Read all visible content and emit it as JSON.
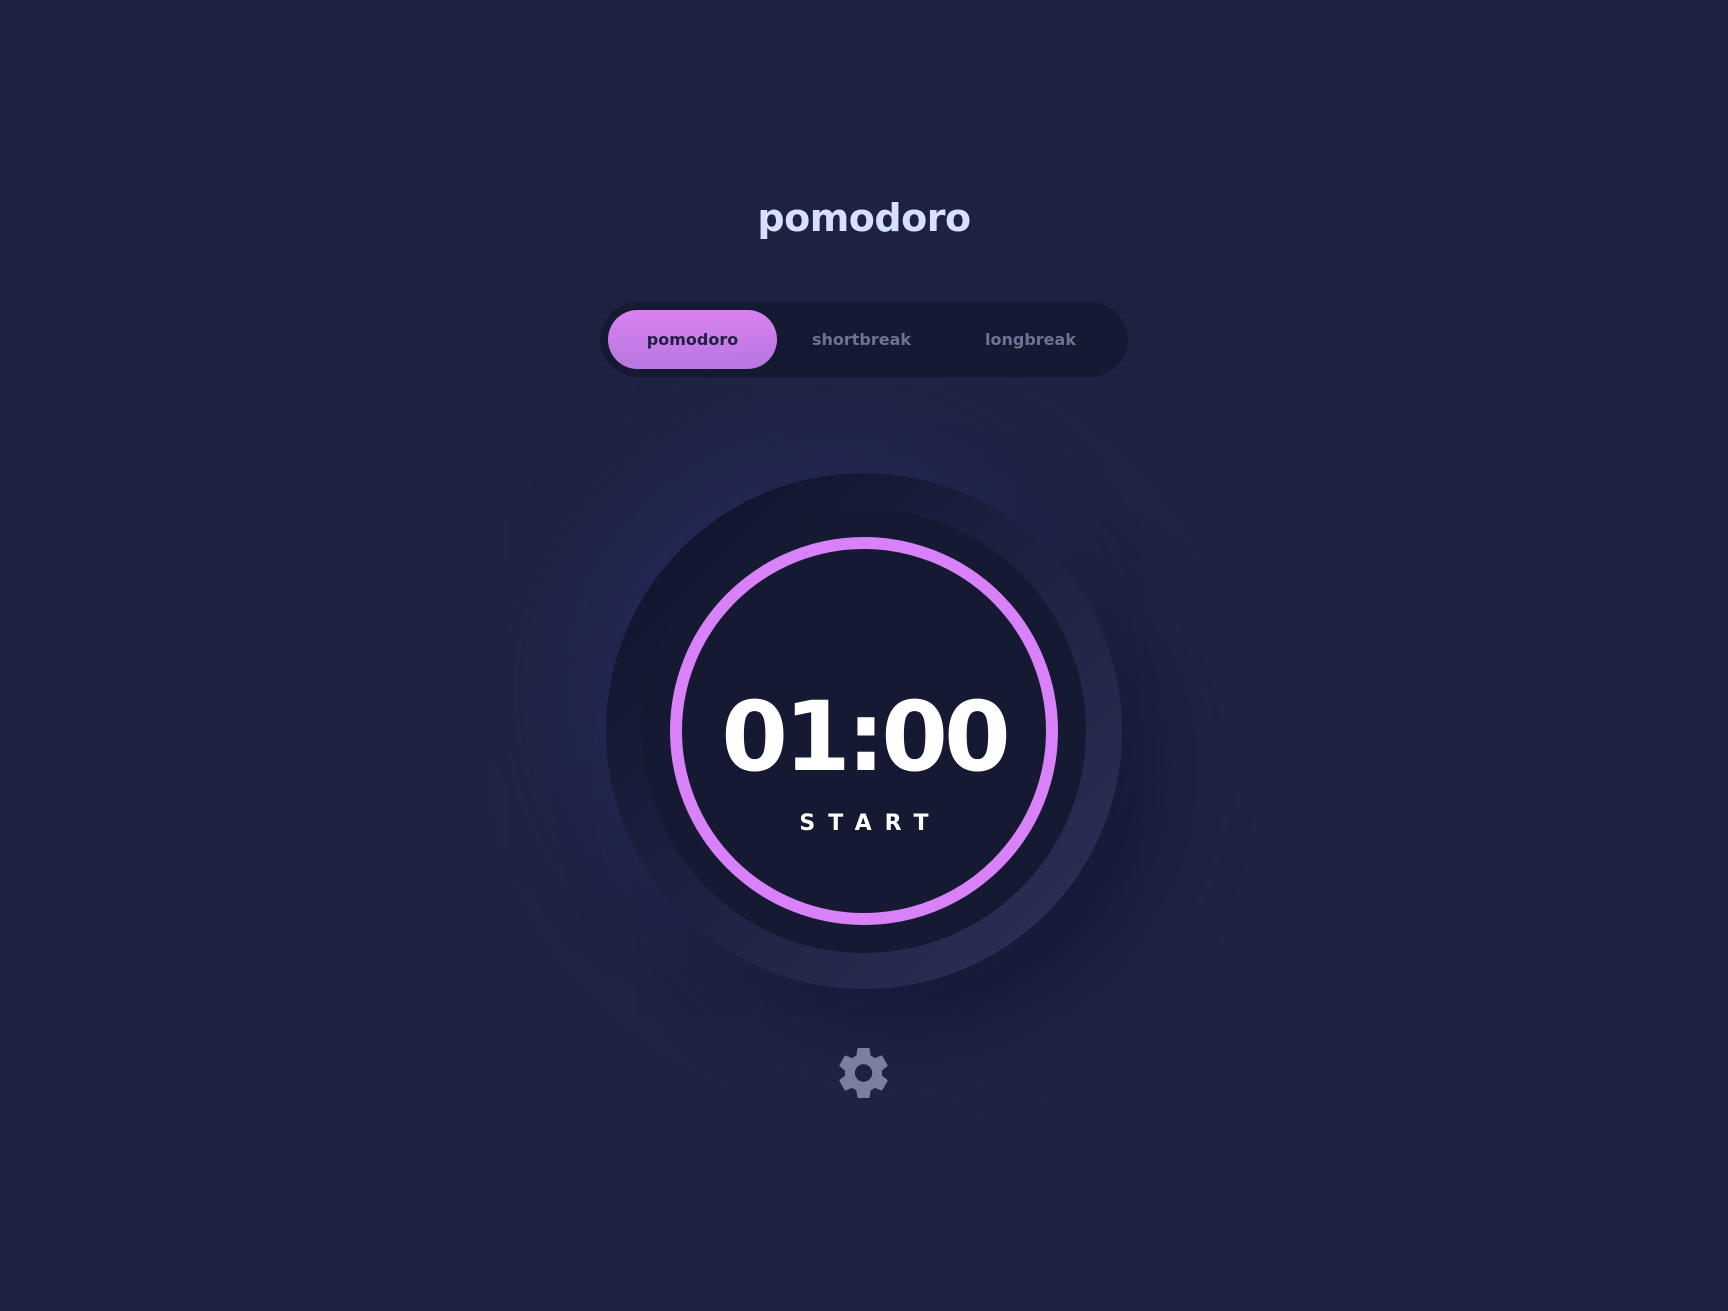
{
  "app": {
    "title": "pomodoro"
  },
  "modes": {
    "items": [
      {
        "label": "pomodoro",
        "active": true
      },
      {
        "label": "shortbreak",
        "active": false
      },
      {
        "label": "longbreak",
        "active": false
      }
    ]
  },
  "timer": {
    "time": "01:00",
    "action_label": "START",
    "progress": 1.0
  },
  "settings": {
    "icon": "gear-icon"
  },
  "colors": {
    "background": "#1e2140",
    "panel": "#161932",
    "accent": "#d881f8",
    "title": "#d7e0fe",
    "inactive_text": "#6f7292",
    "icon": "#7a7f9e"
  }
}
